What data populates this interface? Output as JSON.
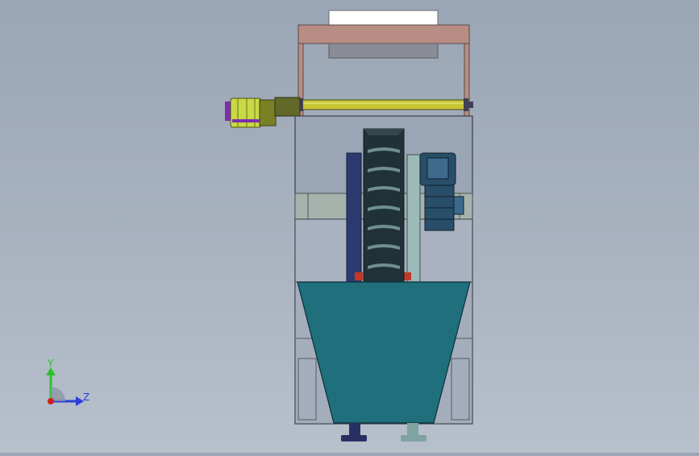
{
  "viewport": {
    "background_top": "#9aa6b6",
    "background_bottom": "#b7c0cb"
  },
  "model": {
    "frame_color": "#b88d84",
    "body_color": "#aab1c1",
    "hopper_color": "#1f6f7c",
    "conveyor_color": "#203237",
    "motor_color": "#294e69",
    "roller_color": "#c7c538",
    "drive_color": "#c9d846",
    "drive_accent": "#7d2db0"
  },
  "triad": {
    "y_label": "Y",
    "z_label": "Z",
    "y_color": "#2ec02e",
    "z_color": "#2b3fd6",
    "origin_color": "#d22020"
  }
}
